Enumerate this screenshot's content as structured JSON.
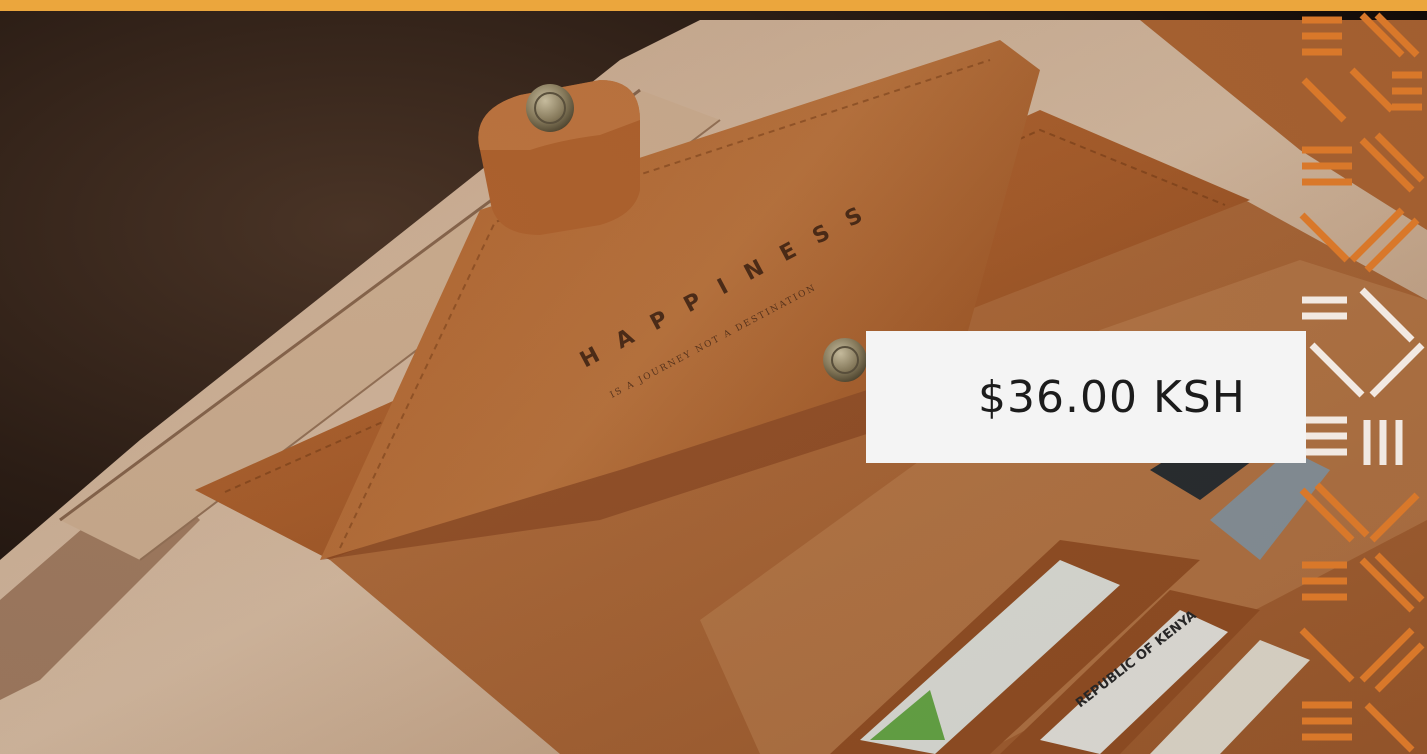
{
  "price": {
    "label": "$36.00 KSH"
  },
  "colors": {
    "accent_bar": "#eba63d",
    "price_box": "#f4f4f4",
    "price_text": "#1c1c1c",
    "pattern_orange": "#d9782a",
    "pattern_white": "#ffffff",
    "leather": "#b8652f"
  },
  "product": {
    "embossed_title": "HAPPINESS",
    "embossed_subtitle": "IS A JOURNEY NOT A DESTINATION",
    "card_text": "REPUBLIC OF KENYA"
  }
}
